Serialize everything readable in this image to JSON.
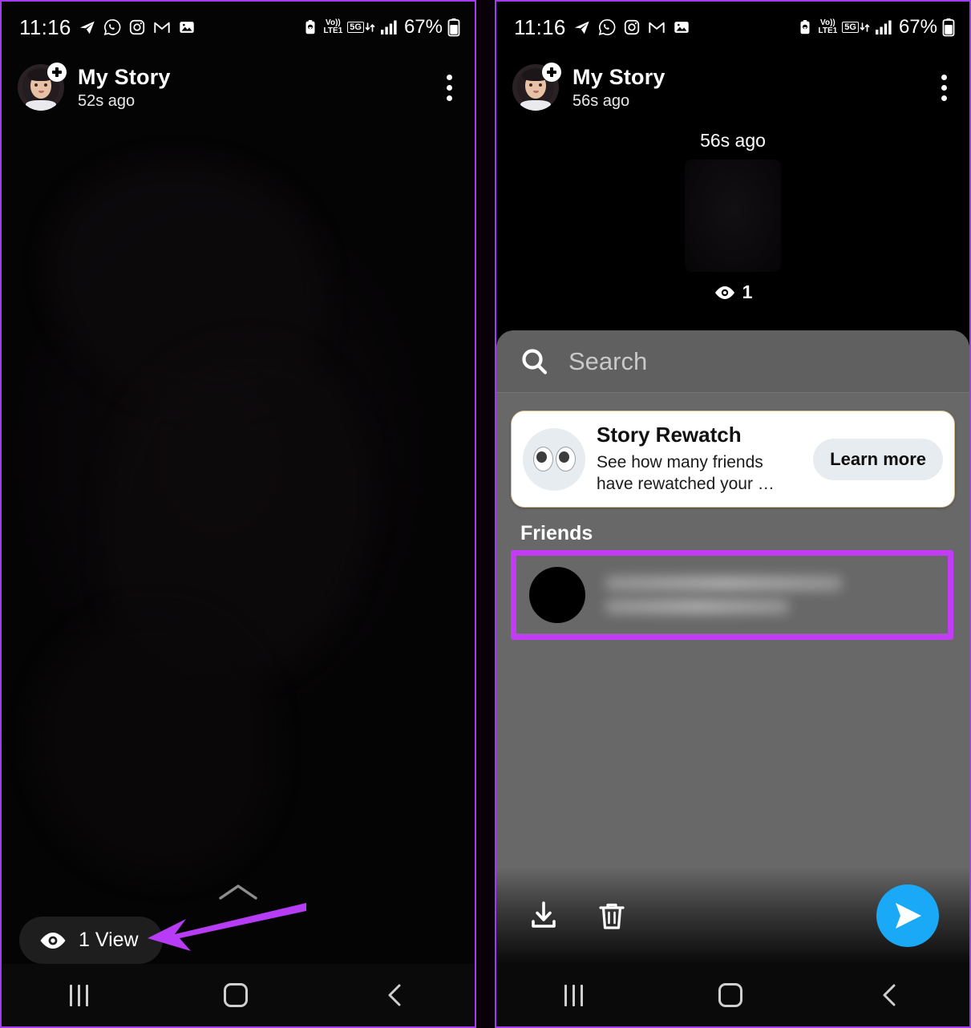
{
  "statusbar": {
    "time": "11:16",
    "app_icons": [
      "telegram-icon",
      "whatsapp-icon",
      "instagram-icon",
      "gmail-icon",
      "photos-icon"
    ],
    "alarm_icon": "battery-saver-icon",
    "volte_line1": "Vo))",
    "volte_line2": "LTE1",
    "network": "5G",
    "battery_percent": "67%"
  },
  "left_panel": {
    "header": {
      "title": "My Story",
      "subtitle": "52s ago",
      "avatar": "bitmoji-avatar",
      "add_badge": "plus-badge-icon",
      "menu": "kebab-menu-icon"
    },
    "view_pill": {
      "icon": "eye-icon",
      "label": "1 View"
    },
    "swipe_hint": "chevron-up-icon",
    "annotation_arrow": {
      "color": "#b73cf5",
      "points_to": "view-pill"
    }
  },
  "right_panel": {
    "header": {
      "title": "My Story",
      "subtitle": "56s ago",
      "avatar": "bitmoji-avatar",
      "add_badge": "plus-badge-icon",
      "menu": "kebab-menu-icon"
    },
    "preview": {
      "time_label": "56s ago",
      "view_icon": "eye-icon",
      "view_count": "1"
    },
    "sheet": {
      "search": {
        "icon": "search-icon",
        "placeholder": "Search"
      },
      "promo": {
        "icon": "eyes-emoji-icon",
        "title": "Story Rewatch",
        "description": "See how many friends have rewatched your …",
        "button_label": "Learn more",
        "border_color": "#d8c08e"
      },
      "friends_heading": "Friends",
      "friend_rows": [
        {
          "avatar": "friend-avatar",
          "name_blurred": true,
          "highlighted": true
        }
      ],
      "highlight_color": "#c23bf5",
      "actions": {
        "download": "download-icon",
        "delete": "trash-icon",
        "send": "send-icon",
        "send_color": "#19a9f7"
      }
    }
  },
  "navbar": {
    "recents": "recents-icon",
    "home": "home-icon",
    "back": "back-icon"
  },
  "colors": {
    "panel_border": "#a23bf0",
    "sheet_bg": "#686868",
    "search_bg": "#606060",
    "accent_magenta": "#c23bf5",
    "send_blue": "#19a9f7"
  }
}
